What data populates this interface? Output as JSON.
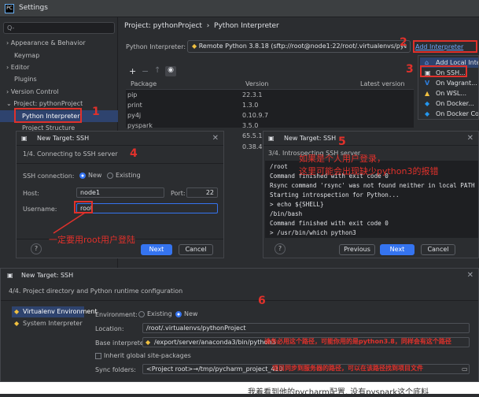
{
  "window": {
    "title": "Settings"
  },
  "search": {
    "placeholder": "Q-"
  },
  "sidebar": {
    "items": [
      "Appearance & Behavior",
      "Keymap",
      "Editor",
      "Plugins",
      "Version Control",
      "Project: pythonProject",
      "Python Interpreter",
      "Project Structure"
    ]
  },
  "breadcrumb": {
    "project": "Project: pythonProject",
    "sep": "›",
    "page": "Python Interpreter"
  },
  "interpreter": {
    "label": "Python Interpreter:",
    "value": "Remote Python 3.8.18 (sftp://root@node1:22/root/.virtualenvs/pyt"
  },
  "add_interpreter": "Add Interpreter",
  "table": {
    "headers": [
      "Package",
      "Version",
      "Latest version"
    ],
    "rows": [
      [
        "pip",
        "22.3.1"
      ],
      [
        "print",
        "1.3.0"
      ],
      [
        "py4j",
        "0.10.9.7"
      ],
      [
        "pyspark",
        "3.5.0"
      ],
      [
        "",
        "65.5.1"
      ],
      [
        "",
        "0.38.4"
      ]
    ]
  },
  "dropdown": {
    "items": [
      "Add Local Inte",
      "On SSH...",
      "On Vagrant...",
      "On WSL...",
      "On Docker...",
      "On Docker Com"
    ]
  },
  "ssh1": {
    "title": "New Target: SSH",
    "step": "1/4. Connecting to SSH server",
    "conn_label": "SSH connection:",
    "new": "New",
    "existing": "Existing",
    "host_label": "Host:",
    "host": "node1",
    "port_label": "Port:",
    "port": "22",
    "user_label": "Username:",
    "user": "root",
    "next": "Next",
    "cancel": "Cancel",
    "help": "?"
  },
  "ssh2": {
    "title": "New Target: SSH",
    "step": "3/4. Introspecting SSH server",
    "lines": [
      "/root",
      "Command finished with exit code 0",
      "Rsync command 'rsync' was not found neither in local PATH",
      "Starting introspection for Python...",
      "> echo ${SHELL}",
      "/bin/bash",
      "Command finished with exit code 0",
      "> /usr/bin/which python3"
    ],
    "previous": "Previous",
    "next": "Next",
    "cancel": "Cancel",
    "help": "?"
  },
  "ssh3": {
    "title": "New Target: SSH",
    "step": "4/4. Project directory and Python runtime configuration",
    "left_items": [
      "Virtualenv Environment",
      "System Interpreter"
    ],
    "env_label": "Environment:",
    "existing": "Existing",
    "new": "New",
    "location_label": "Location:",
    "location": "/root/.virtualenvs/pythonProject",
    "base_label": "Base interpreter:",
    "base": "/export/server/anaconda3/bin/python3",
    "inherit": "Inherit global site-packages",
    "sync_label": "Sync folders:",
    "sync": "<Project root>→/tmp/pycharm_project_410"
  },
  "annotations": {
    "n1": "1",
    "n2": "2",
    "n3": "3",
    "n4": "4",
    "n5": "5",
    "n6": "6",
    "note_root": "一定要用root用户登陆",
    "note_5a": "如果是个人用户登录，",
    "note_5b": "这里可能会出现缺少python3的报错",
    "note_base": "请务必用这个路径，可能你用的是python3.8，同样会有这个路径",
    "note_sync": "项目同步到服务器的路径，可以在该路径找到项目文件",
    "bottom": "我着看到他的pycharm配置, 没有pyspark这个底料"
  },
  "colors": {
    "accent": "#3574f0",
    "annotation": "#e0312b"
  }
}
